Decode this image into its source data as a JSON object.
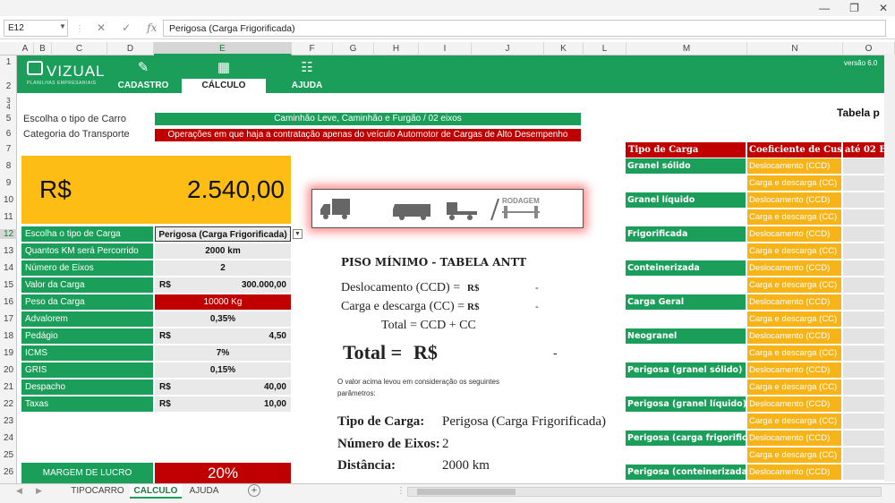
{
  "formula_bar": {
    "name_box": "E12",
    "content": "Perigosa (Carga Frigorificada)"
  },
  "columns": [
    "A",
    "B",
    "C",
    "D",
    "E",
    "F",
    "G",
    "H",
    "I",
    "J",
    "K",
    "L",
    "M",
    "N",
    "O"
  ],
  "rows": [
    "1",
    "2",
    "3",
    "4",
    "5",
    "6",
    "7",
    "8",
    "9",
    "10",
    "11",
    "12",
    "13",
    "14",
    "15",
    "16",
    "17",
    "18",
    "19",
    "20",
    "21",
    "22",
    "23",
    "24",
    "25",
    "26"
  ],
  "ribbon": {
    "logo": "VIZUAL",
    "logo_sub": "PLANILHAS EMPRESARIAIS",
    "tabs": [
      {
        "label": "CADASTRO",
        "icon": "pencil-icon"
      },
      {
        "label": "CÁLCULO",
        "icon": "calculator-icon"
      },
      {
        "label": "AJUDA",
        "icon": "help-people-icon"
      }
    ],
    "version": "versão 6.0"
  },
  "header_rows": {
    "carro_label": "Escolha o tipo de Carro",
    "carro_value": "Caminhão Leve, Caminhão e Furgão / 02 eixos",
    "categoria_label": "Categoria do Transporte",
    "categoria_value": "Operações em que haja a contratação apenas do veículo Automotor de Cargas de Alto Desempenho"
  },
  "total_box": {
    "currency": "R$",
    "value": "2.540,00"
  },
  "vehicle_banner": {
    "label": "RODAGEM"
  },
  "params": [
    {
      "label": "Escolha o tipo de Carga",
      "prefix": "",
      "value": "Perigosa (Carga Frigorificada)"
    },
    {
      "label": "Quantos KM será Percorrido",
      "prefix": "",
      "value": "2000 km"
    },
    {
      "label": "Número de Eixos",
      "prefix": "",
      "value": "2"
    },
    {
      "label": "Valor da Carga",
      "prefix": "R$",
      "value": "300.000,00"
    },
    {
      "label": "Peso da Carga",
      "prefix": "",
      "value": "10000 Kg"
    },
    {
      "label": "Advalorem",
      "prefix": "",
      "value": "0,35%"
    },
    {
      "label": "Pedágio",
      "prefix": "R$",
      "value": "4,50"
    },
    {
      "label": "ICMS",
      "prefix": "",
      "value": "7%"
    },
    {
      "label": "GRIS",
      "prefix": "",
      "value": "0,15%"
    },
    {
      "label": "Despacho",
      "prefix": "R$",
      "value": "40,00"
    },
    {
      "label": "Taxas",
      "prefix": "R$",
      "value": "10,00"
    }
  ],
  "margem": {
    "label": "MARGEM DE LUCRO",
    "value": "20%"
  },
  "piso": {
    "title": "PISO MÍNIMO - TABELA ANTT",
    "ccd_label": "Deslocamento (CCD) =",
    "ccd_cur": "R$",
    "ccd_val": "-",
    "cc_label": "Carga e descarga (CC) =",
    "cc_cur": "R$",
    "cc_val": "-",
    "formula": "Total = CCD + CC",
    "total_label": "Total =",
    "total_cur": "R$",
    "total_val": "-",
    "note": "O valor acima levou em consideração os seguintes parâmetros:",
    "tipo_label": "Tipo de Carga:",
    "tipo_value": "Perigosa (Carga Frigorificada)",
    "eixos_label": "Número de Eixos:",
    "eixos_value": "2",
    "dist_label": "Distância:",
    "dist_value": "2000 km"
  },
  "tabela": {
    "title": "Tabela p",
    "headers": [
      "Tipo de Carga",
      "Coeficiente de Custo",
      "até 02 E"
    ],
    "rows": [
      {
        "tipo": "Granel sólido",
        "coef1": "Deslocamento (CCD)",
        "coef2": "Carga e descarga (CC)"
      },
      {
        "tipo": "Granel líquido",
        "coef1": "Deslocamento (CCD)",
        "coef2": "Carga e descarga (CC)"
      },
      {
        "tipo": "Frigorificada",
        "coef1": "Deslocamento (CCD)",
        "coef2": "Carga e descarga (CC)"
      },
      {
        "tipo": "Conteinerizada",
        "coef1": "Deslocamento (CCD)",
        "coef2": "Carga e descarga (CC)"
      },
      {
        "tipo": "Carga Geral",
        "coef1": "Deslocamento (CCD)",
        "coef2": "Carga e descarga (CC)"
      },
      {
        "tipo": "Neogranel",
        "coef1": "Deslocamento (CCD)",
        "coef2": "Carga e descarga (CC)"
      },
      {
        "tipo": "Perigosa (granel sólido)",
        "coef1": "Deslocamento (CCD)",
        "coef2": "Carga e descarga (CC)"
      },
      {
        "tipo": "Perigosa (granel líquido)",
        "coef1": "Deslocamento (CCD)",
        "coef2": "Carga e descarga (CC)"
      },
      {
        "tipo": "Perigosa (carga frigorificad",
        "coef1": "Deslocamento (CCD)",
        "coef2": "Carga e descarga (CC)"
      },
      {
        "tipo": "Perigosa (conteinerizada)",
        "coef1": "Deslocamento (CCD)",
        "coef2": ""
      }
    ]
  },
  "sheets": [
    "TIPOCARRO",
    "CALCULO",
    "AJUDA"
  ],
  "colors": {
    "green": "#1b9e5a",
    "red": "#c00000",
    "yellow": "#f6b418",
    "gold": "#fdbd14"
  }
}
